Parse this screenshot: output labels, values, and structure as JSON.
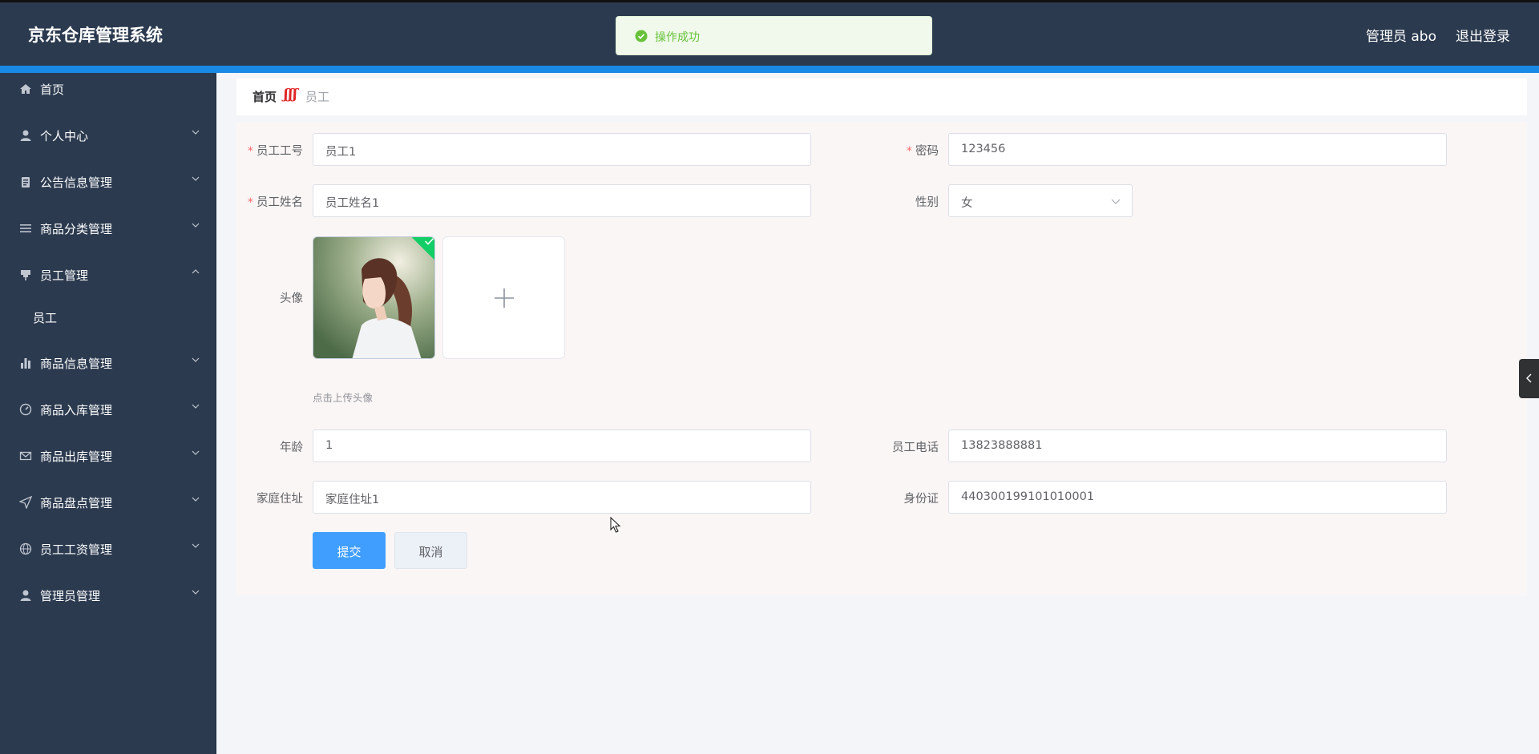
{
  "header": {
    "title": "京东仓库管理系统",
    "user": "管理员 abo",
    "logout": "退出登录"
  },
  "toast": {
    "message": "操作成功",
    "type": "success",
    "color": "#67c23a"
  },
  "sidebar": {
    "items": [
      {
        "label": "首页",
        "icon": "home-icon"
      },
      {
        "label": "个人中心",
        "icon": "user-icon"
      },
      {
        "label": "公告信息管理",
        "icon": "clipboard-icon"
      },
      {
        "label": "商品分类管理",
        "icon": "list-icon"
      },
      {
        "label": "员工管理",
        "icon": "pin-icon",
        "expanded": true,
        "children": [
          {
            "label": "员工"
          }
        ]
      },
      {
        "label": "商品信息管理",
        "icon": "bar-chart-icon"
      },
      {
        "label": "商品入库管理",
        "icon": "gauge-icon"
      },
      {
        "label": "商品出库管理",
        "icon": "mail-icon"
      },
      {
        "label": "商品盘点管理",
        "icon": "send-icon"
      },
      {
        "label": "员工工资管理",
        "icon": "globe-icon"
      },
      {
        "label": "管理员管理",
        "icon": "user-icon"
      }
    ]
  },
  "breadcrumb": {
    "home": "首页",
    "separator": "ʃʃʃ",
    "current": "员工"
  },
  "form": {
    "employee_no": {
      "label": "员工工号",
      "value": "员工1",
      "required": true
    },
    "password": {
      "label": "密码",
      "value": "123456",
      "required": true
    },
    "name": {
      "label": "员工姓名",
      "value": "员工姓名1",
      "required": true
    },
    "gender": {
      "label": "性别",
      "value": "女"
    },
    "avatar": {
      "label": "头像",
      "tip": "点击上传头像"
    },
    "age": {
      "label": "年龄",
      "value": "1"
    },
    "phone": {
      "label": "员工电话",
      "value": "13823888881"
    },
    "address": {
      "label": "家庭住址",
      "value": "家庭住址1"
    },
    "id_card": {
      "label": "身份证",
      "value": "440300199101010001"
    }
  },
  "buttons": {
    "submit": "提交",
    "cancel": "取消"
  },
  "colors": {
    "header_bg": "#2b3a4f",
    "accent": "#1989e6",
    "primary": "#409eff",
    "required": "#f56c6c",
    "success": "#13ce66"
  }
}
